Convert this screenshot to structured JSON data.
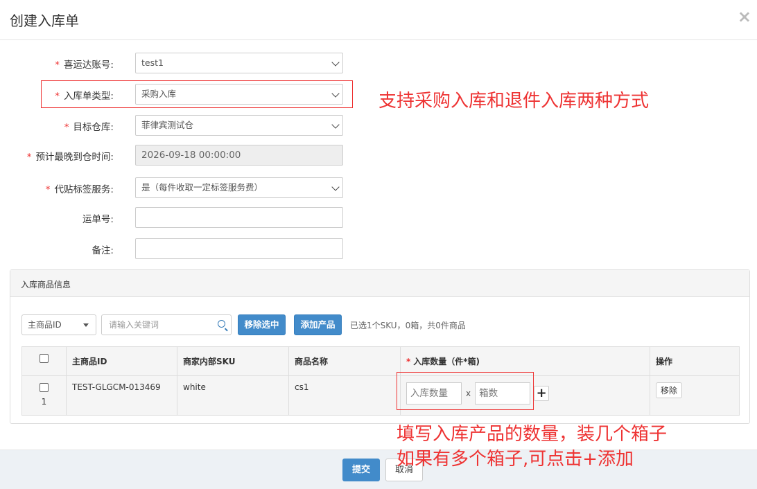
{
  "modal": {
    "title": "创建入库单",
    "close_glyph": "×"
  },
  "form": {
    "account": {
      "label": "喜运达账号:",
      "value": "test1",
      "required": "*"
    },
    "type": {
      "label": "入库单类型:",
      "value": "采购入库",
      "required": "*"
    },
    "warehouse": {
      "label": "目标仓库:",
      "value": "菲律宾测试仓",
      "required": "*"
    },
    "arrival_time": {
      "label": "预计最晚到仓时间:",
      "value": "2026-09-18 00:00:00",
      "required": "*"
    },
    "label_service": {
      "label": "代贴标签服务:",
      "value": "是（每件收取一定标签服务费）",
      "required": "*"
    },
    "tracking_no": {
      "label": "运单号:",
      "value": ""
    },
    "remark": {
      "label": "备注:",
      "value": ""
    }
  },
  "annotations": {
    "type_note": "支持采购入库和退件入库两种方式",
    "qty_note_line1": "填写入库产品的数量，装几个箱子",
    "qty_note_line2": "如果有多个箱子,可点击+添加"
  },
  "products_panel": {
    "heading": "入库商品信息",
    "filter_select": "主商品ID",
    "search_placeholder": "请输入关键词",
    "remove_selected": "移除选中",
    "add_product": "添加产品",
    "summary": "已选1个SKU，0箱，共0件商品",
    "columns": {
      "product_id": "主商品ID",
      "internal_sku": "商家内部SKU",
      "product_name": "商品名称",
      "qty_required": "*",
      "qty": "入库数量（件*箱)",
      "action": "操作"
    },
    "rows": [
      {
        "index": "1",
        "product_id": "TEST-GLGCM-013469",
        "internal_sku": "white",
        "product_name": "cs1",
        "qty_placeholder": "入库数量",
        "box_placeholder": "箱数",
        "times": "x",
        "plus": "+",
        "remove": "移除"
      }
    ]
  },
  "footer": {
    "submit": "提交",
    "cancel": "取消"
  },
  "colors": {
    "primary": "#428bca",
    "annotation_red": "#ee3333"
  }
}
